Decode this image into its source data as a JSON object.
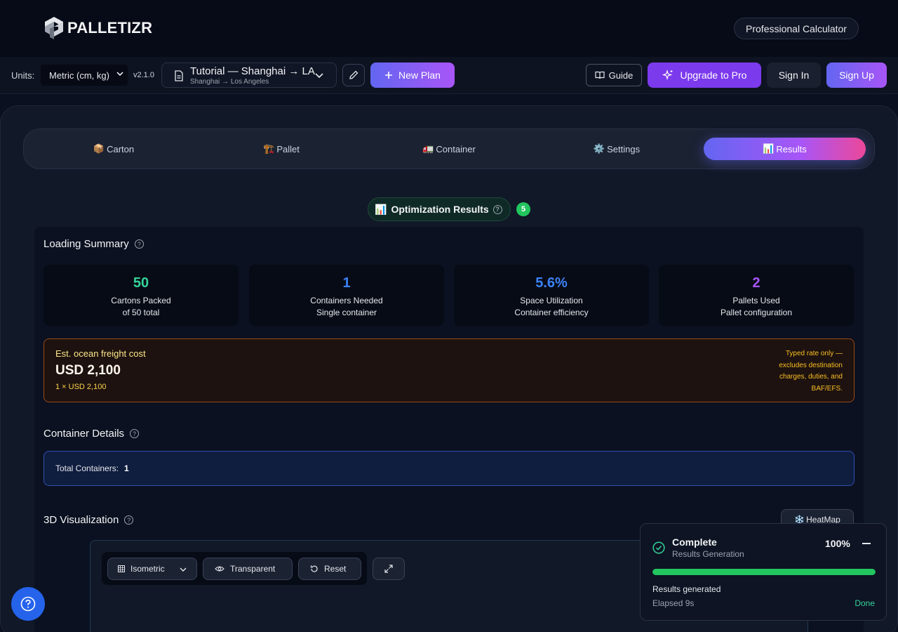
{
  "header": {
    "logo_text": "PALLETIZR",
    "pro_calculator": "Professional Calculator"
  },
  "toolbar": {
    "units_label": "Units:",
    "units_value": "Metric (cm, kg)",
    "version": "v2.1.0",
    "plan_title": "Tutorial — Shanghai → LA",
    "plan_subtitle": "Shanghai → Los Angeles",
    "new_plan": "New Plan",
    "guide": "Guide",
    "upgrade": "Upgrade to Pro",
    "sign_in": "Sign In",
    "sign_up": "Sign Up"
  },
  "tabs": [
    {
      "emoji": "📦",
      "label": "Carton"
    },
    {
      "emoji": "🏗️",
      "label": "Pallet"
    },
    {
      "emoji": "🚛",
      "label": "Container"
    },
    {
      "emoji": "⚙️",
      "label": "Settings"
    },
    {
      "emoji": "📊",
      "label": "Results",
      "active": true
    }
  ],
  "results": {
    "emoji": "📊",
    "title": "Optimization Results",
    "badge": "5"
  },
  "loading_summary": {
    "title": "Loading Summary",
    "cards": [
      {
        "value": "50",
        "label": "Cartons Packed",
        "sub": "of 50 total",
        "color": "#34d399"
      },
      {
        "value": "1",
        "label": "Containers Needed",
        "sub": "Single container",
        "color": "#3b82f6"
      },
      {
        "value": "5.6%",
        "label": "Space Utilization",
        "sub": "Container efficiency",
        "color": "#3b82f6"
      },
      {
        "value": "2",
        "label": "Pallets Used",
        "sub": "Pallet configuration",
        "color": "#a855f7"
      }
    ]
  },
  "freight": {
    "label": "Est. ocean freight cost",
    "value": "USD 2,100",
    "sub": "1 × USD 2,100",
    "note": "Typed rate only — excludes destination charges, duties, and BAF/EFS."
  },
  "container_details": {
    "title": "Container Details",
    "total_label": "Total Containers:",
    "total_value": "1"
  },
  "visualization": {
    "title": "3D Visualization",
    "heatmap": "HeatMap",
    "heatmap_emoji": "❄️",
    "view_mode": "Isometric",
    "transparent": "Transparent",
    "reset": "Reset"
  },
  "toast": {
    "title": "Complete",
    "subtitle": "Results Generation",
    "percent": "100%",
    "progress": 1.0,
    "message": "Results generated",
    "elapsed": "Elapsed 9s",
    "status": "Done"
  }
}
